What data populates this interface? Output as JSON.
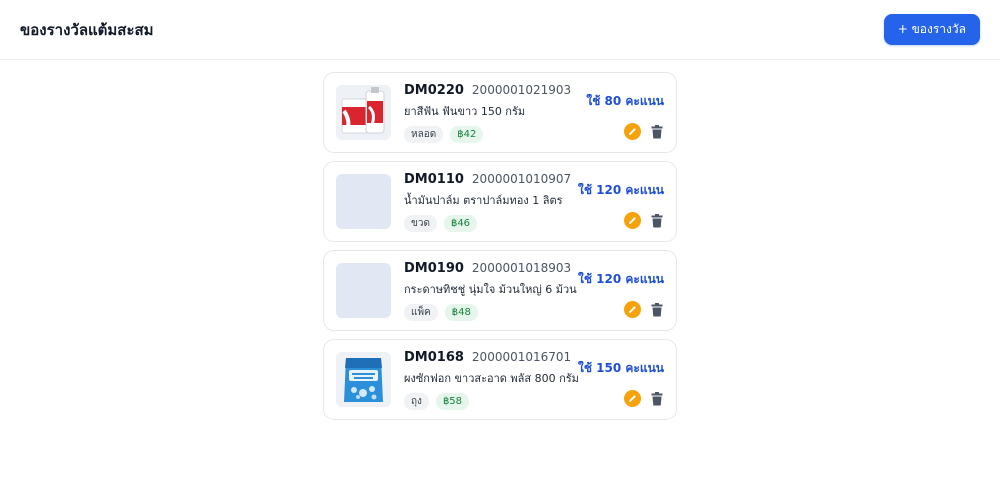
{
  "header": {
    "title": "ของรางวัลแต้มสะสม",
    "add_label": "+ ของรางวัล"
  },
  "rewards": [
    {
      "code": "DM0220",
      "barcode": "2000001021903",
      "name": "ยาสีฟัน ฟันขาว 150 กรัม",
      "unit": "หลอด",
      "price": "฿42",
      "points": "ใช้ 80 คะแนน",
      "image": "toothpaste"
    },
    {
      "code": "DM0110",
      "barcode": "2000001010907",
      "name": "น้ำมันปาล์ม ตราปาล์มทอง 1 ลิตร",
      "unit": "ขวด",
      "price": "฿46",
      "points": "ใช้ 120 คะแนน",
      "image": "none"
    },
    {
      "code": "DM0190",
      "barcode": "2000001018903",
      "name": "กระดาษทิชชู่ นุ่มใจ ม้วนใหญ่ 6 ม้วน",
      "unit": "แพ็ค",
      "price": "฿48",
      "points": "ใช้ 120 คะแนน",
      "image": "none"
    },
    {
      "code": "DM0168",
      "barcode": "2000001016701",
      "name": "ผงซักฟอก ขาวสะอาด พลัส 800 กรัม",
      "unit": "ถุง",
      "price": "฿58",
      "points": "ใช้ 150 คะแนน",
      "image": "detergent-bag"
    }
  ],
  "colors": {
    "accent": "#2563eb",
    "points": "#1d4ed8",
    "edit": "#f5a20b",
    "price_badge": "#16803c"
  },
  "icons": {
    "edit": "pencil-icon",
    "delete": "trash-icon"
  }
}
